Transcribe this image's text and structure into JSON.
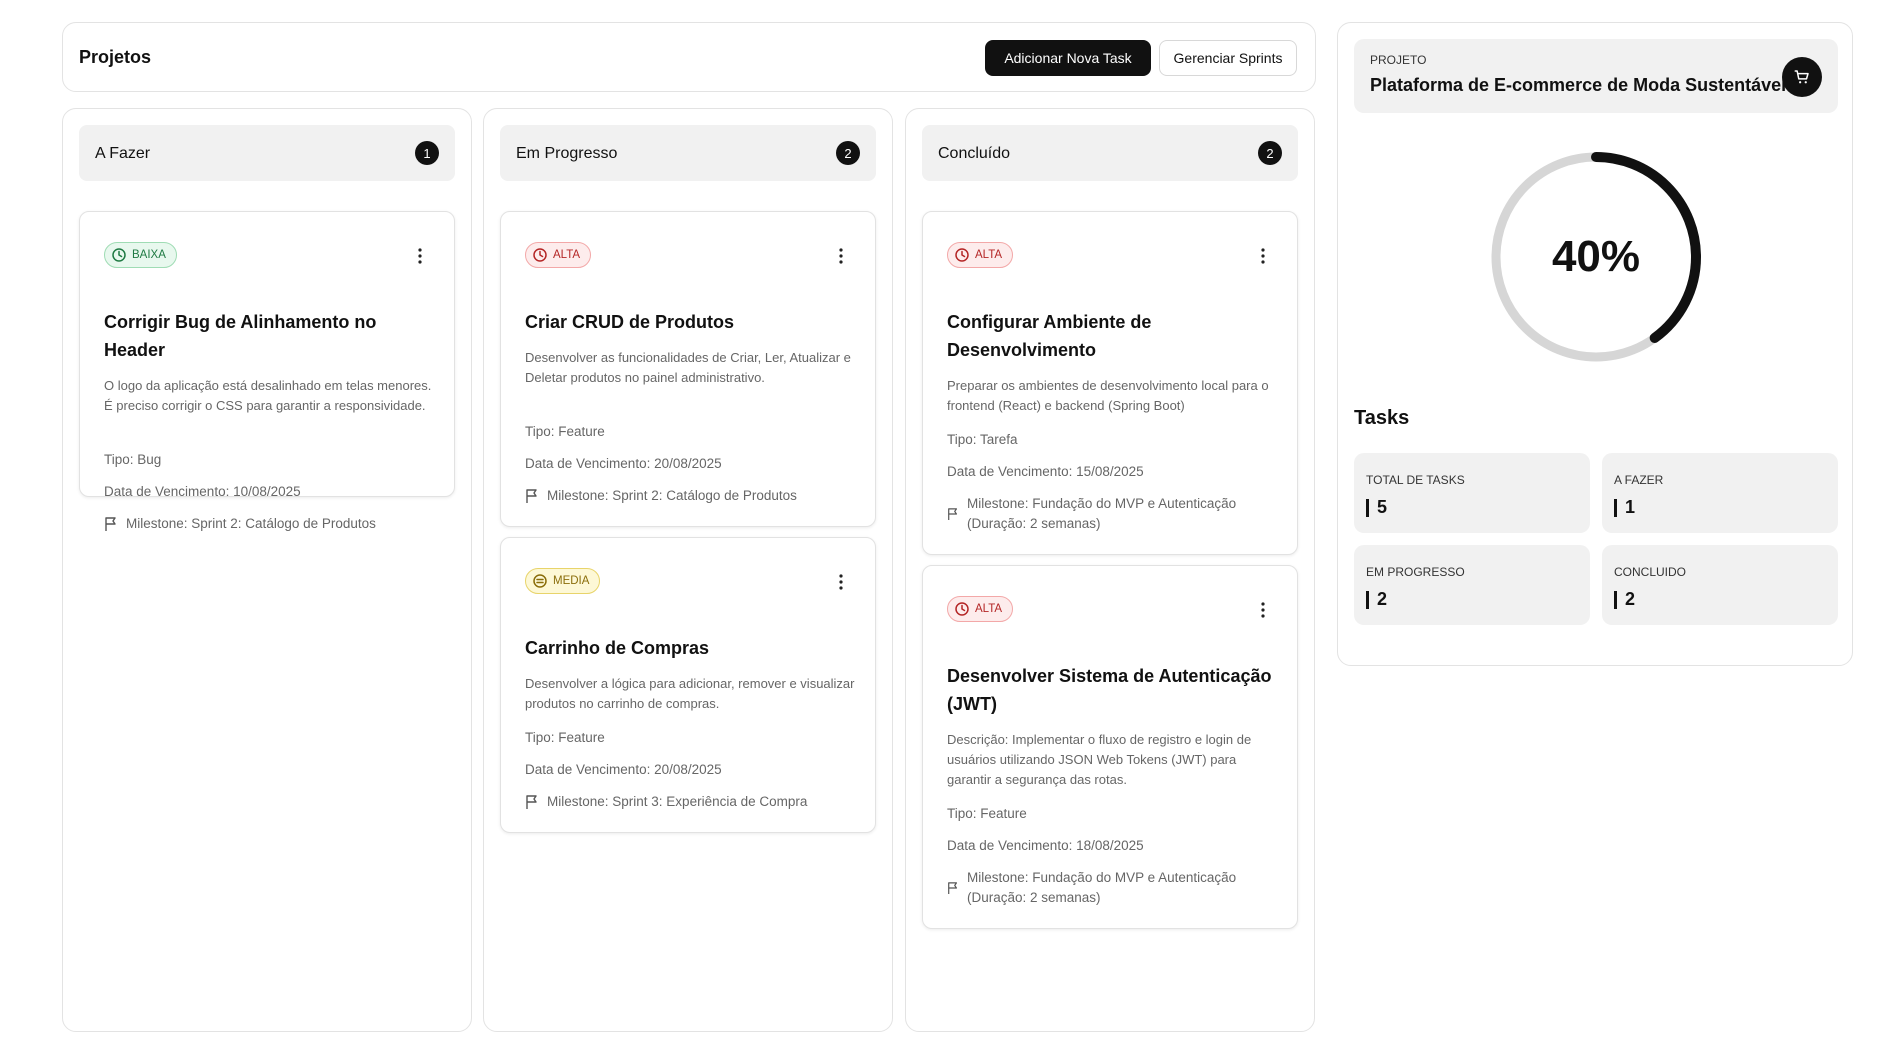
{
  "header": {
    "title": "Projetos",
    "add_task_label": "Adicionar Nova Task",
    "manage_sprints_label": "Gerenciar Sprints"
  },
  "columns": [
    {
      "label": "A Fazer",
      "count": "1",
      "cards": [
        {
          "priority": "BAIXA",
          "title": "Corrigir Bug de Alinhamento no Header",
          "description": "O logo da aplicação está desalinhado em telas menores. É preciso corrigir o CSS para garantir a responsividade.",
          "type": "Tipo: Bug",
          "due": "Data de Vencimento: 10/08/2025",
          "milestone": "Milestone: Sprint 2: Catálogo de Produtos"
        }
      ]
    },
    {
      "label": "Em Progresso",
      "count": "2",
      "cards": [
        {
          "priority": "ALTA",
          "title": "Criar CRUD de Produtos",
          "description": "Desenvolver as funcionalidades de Criar, Ler, Atualizar e Deletar produtos no painel administrativo.",
          "type": "Tipo: Feature",
          "due": "Data de Vencimento: 20/08/2025",
          "milestone": "Milestone: Sprint 2: Catálogo de Produtos"
        },
        {
          "priority": "MEDIA",
          "title": "Carrinho de Compras",
          "description": "Desenvolver a lógica para adicionar, remover e visualizar produtos no carrinho de compras.",
          "type": "Tipo: Feature",
          "due": "Data de Vencimento: 20/08/2025",
          "milestone": "Milestone: Sprint 3: Experiência de Compra"
        }
      ]
    },
    {
      "label": "Concluído",
      "count": "2",
      "cards": [
        {
          "priority": "ALTA",
          "title": "Configurar Ambiente de Desenvolvimento",
          "description": "Preparar os ambientes de desenvolvimento local para o frontend (React) e backend (Spring Boot)",
          "type": "Tipo: Tarefa",
          "due": "Data de Vencimento: 15/08/2025",
          "milestone": "Milestone: Fundação do MVP e Autenticação (Duração: 2 semanas)"
        },
        {
          "priority": "ALTA",
          "title": "Desenvolver Sistema de Autenticação (JWT)",
          "description": "Descrição: Implementar o fluxo de registro e login de usuários utilizando JSON Web Tokens (JWT) para garantir a segurança das rotas.",
          "type": "Tipo: Feature",
          "due": "Data de Vencimento: 18/08/2025",
          "milestone": "Milestone: Fundação do MVP e Autenticação (Duração: 2 semanas)"
        }
      ]
    }
  ],
  "project": {
    "caption": "PROJETO",
    "name": "Plataforma de E-commerce de Moda Sustentável",
    "icon": "shopping-cart-icon",
    "progress_label": "40%",
    "progress_fraction": 0.4
  },
  "tasks": {
    "heading": "Tasks",
    "total_caption": "TOTAL DE TASKS",
    "total_value": "5",
    "afazer_caption": "A FAZER",
    "afazer_value": "1",
    "progresso_caption": "EM PROGRESSO",
    "progresso_value": "2",
    "concluido_caption": "CONCLUIDO",
    "concluido_value": "2"
  },
  "colors": {
    "accent": "#111111",
    "baixa": "#1f7a43",
    "alta": "#b42626",
    "media": "#8a6d0a"
  }
}
